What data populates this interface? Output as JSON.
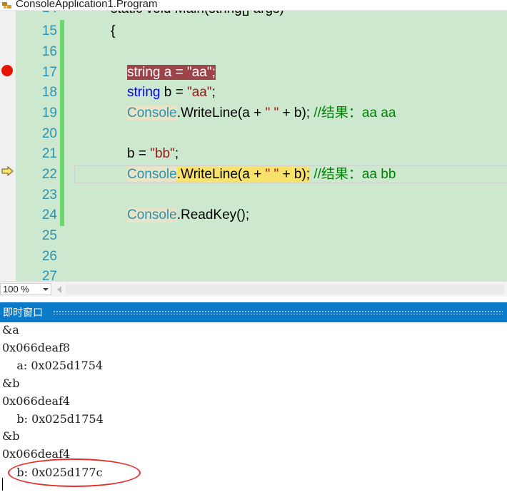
{
  "breadcrumb": {
    "label": "ConsoleApplication1.Program"
  },
  "editor": {
    "top_partial": "static void Main(string[] args)",
    "lines": [
      {
        "num": "15",
        "text": "{"
      },
      {
        "num": "16",
        "text": ""
      },
      {
        "num": "17",
        "text": "string a = \"aa\";"
      },
      {
        "num": "18",
        "text": "string b = \"aa\";"
      },
      {
        "num": "19",
        "text": "Console.WriteLine(a + \"  \" + b); //结果：aa  aa"
      },
      {
        "num": "20",
        "text": ""
      },
      {
        "num": "21",
        "text": "b = \"bb\";"
      },
      {
        "num": "22",
        "text": "Console.WriteLine(a + \"  \" + b); //结果：aa  bb"
      },
      {
        "num": "23",
        "text": ""
      },
      {
        "num": "24",
        "text": "Console.ReadKey();"
      },
      {
        "num": "25",
        "text": ""
      },
      {
        "num": "26",
        "text": ""
      },
      {
        "num": "27",
        "text": ""
      }
    ],
    "tokens": {
      "kw_string": "string",
      "a_decl": " a = ",
      "b_decl": " b = ",
      "aa": "\"aa\"",
      "bb": "\"bb\"",
      "semi": ";",
      "console": "Console",
      "writeline_pre": ".WriteLine(a + ",
      "space_str": "\"  \"",
      "writeline_post": " + b);",
      "comment1": " //结果：aa  aa",
      "comment2": " //结果：aa  bb",
      "b_assign": "b = ",
      "readkey": ".ReadKey();",
      "brace": "{"
    }
  },
  "status": {
    "zoom": "100 %"
  },
  "immediate": {
    "title": "即时窗口",
    "output": [
      "&a",
      "0x066deaf8",
      "    a: 0x025d1754",
      "&b",
      "0x066deaf4",
      "    b: 0x025d1754",
      "&b",
      "0x066deaf4",
      "    b: 0x025d177c"
    ]
  },
  "colors": {
    "editor_bg": "#cce8cf",
    "line_number": "#2b91af",
    "breakpoint": "#e51400",
    "breakpoint_line": "#9c4449",
    "current_statement": "#f7e36b",
    "title_bar": "#0a7ac9",
    "annotation": "#e8302a"
  },
  "icons": [
    "class-icon",
    "breakpoint-icon",
    "current-statement-arrow-icon",
    "dropdown-arrow-icon",
    "scroll-left-icon"
  ]
}
